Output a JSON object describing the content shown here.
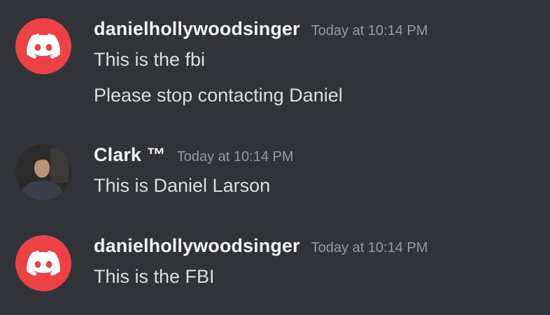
{
  "messages": [
    {
      "username": "danielhollywoodsinger",
      "timestamp": "Today at 10:14 PM",
      "avatar": "discord-default-avatar",
      "avatar_color": "#ED4245",
      "lines": [
        "This is the fbi",
        "Please stop contacting Daniel"
      ]
    },
    {
      "username": "Clark ™",
      "timestamp": "Today at 10:14 PM",
      "avatar": "user-photo-avatar",
      "lines": [
        "This is Daniel Larson"
      ]
    },
    {
      "username": "danielhollywoodsinger",
      "timestamp": "Today at 10:14 PM",
      "avatar": "discord-default-avatar",
      "avatar_color": "#ED4245",
      "lines": [
        "This is the FBI"
      ]
    }
  ],
  "colors": {
    "background": "#313338",
    "username": "#F2F3F5",
    "timestamp": "#949BA4",
    "message_text": "#DBDEE1"
  }
}
